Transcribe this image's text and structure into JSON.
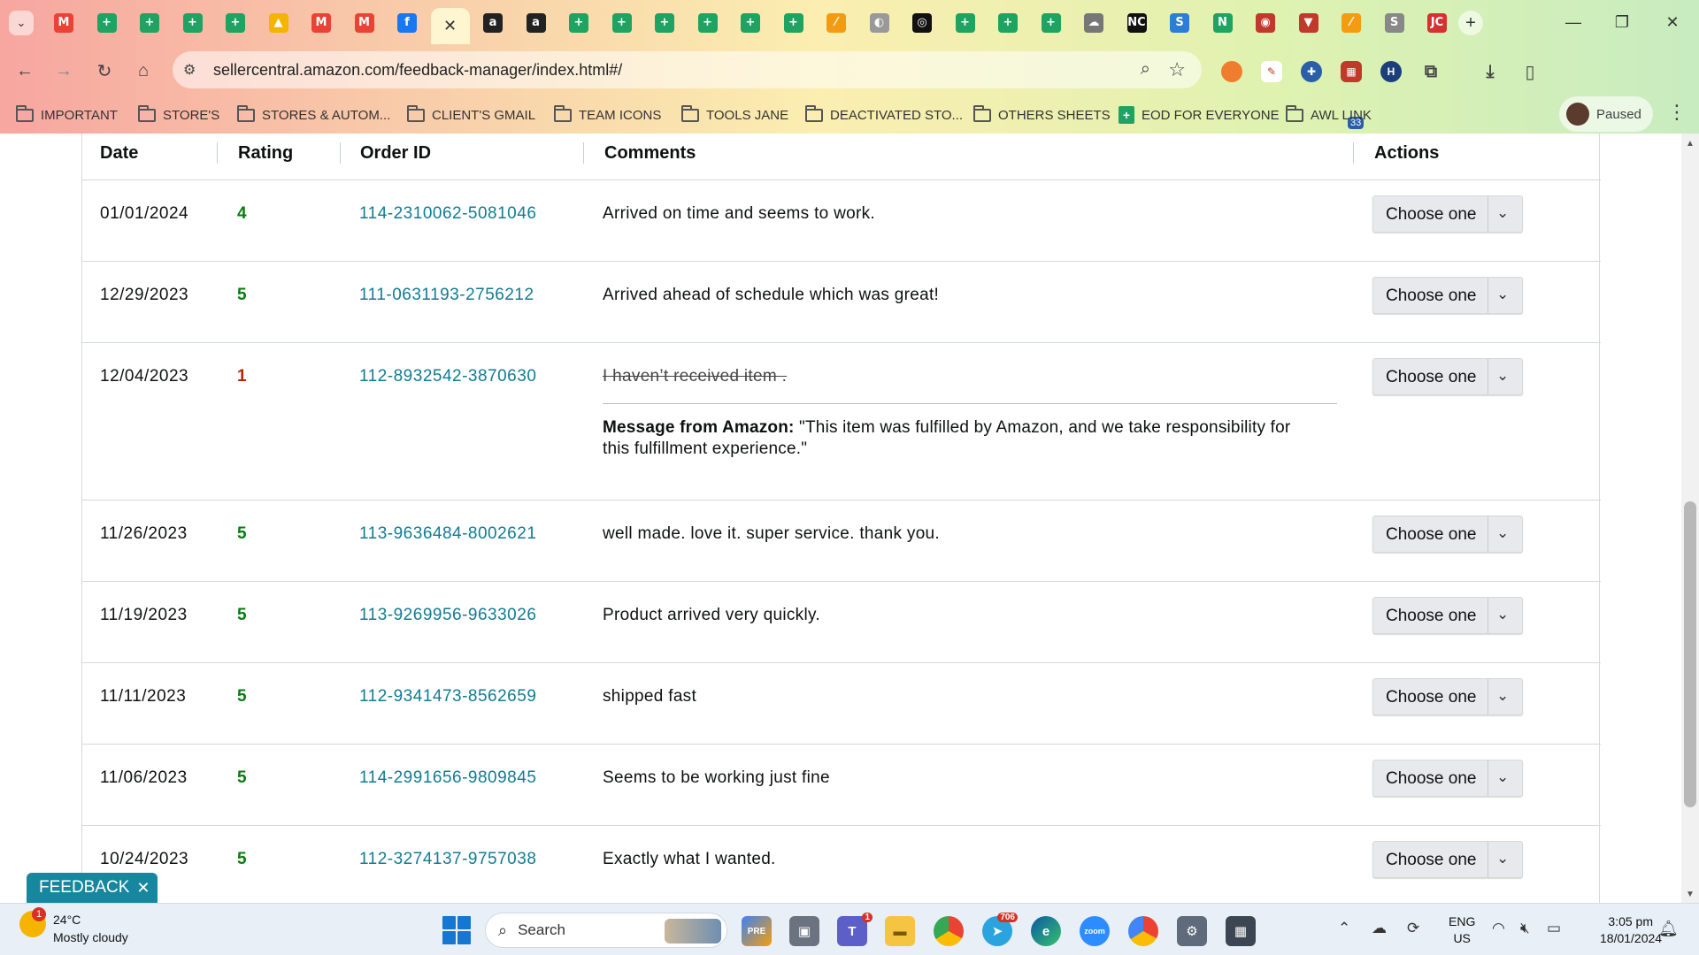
{
  "browser": {
    "url": "sellercentral.amazon.com/feedback-manager/index.html#/",
    "profile_label": "Paused",
    "extension_badge": "33",
    "tabs": [
      {
        "icon": "gmail-icon",
        "glyph": "M",
        "color": "#ea4335"
      },
      {
        "icon": "sheets-icon",
        "glyph": "+",
        "color": "#1ea362"
      },
      {
        "icon": "sheets-icon",
        "glyph": "+",
        "color": "#1ea362"
      },
      {
        "icon": "sheets-icon",
        "glyph": "+",
        "color": "#1ea362"
      },
      {
        "icon": "sheets-icon",
        "glyph": "+",
        "color": "#1ea362"
      },
      {
        "icon": "drive-icon",
        "glyph": "▲",
        "color": "#f4b400"
      },
      {
        "icon": "gmail-icon",
        "glyph": "M",
        "color": "#ea4335"
      },
      {
        "icon": "gmail-icon",
        "glyph": "M",
        "color": "#ea4335"
      },
      {
        "icon": "facebook-icon",
        "glyph": "f",
        "color": "#1877f2"
      },
      {
        "icon": "close-icon",
        "glyph": "✕",
        "color": "transparent",
        "active": true
      },
      {
        "icon": "amazon-icon",
        "glyph": "a",
        "color": "#222"
      },
      {
        "icon": "amazon-icon",
        "glyph": "a",
        "color": "#222"
      },
      {
        "icon": "sheets-icon",
        "glyph": "+",
        "color": "#1ea362"
      },
      {
        "icon": "sheets-icon",
        "glyph": "+",
        "color": "#1ea362"
      },
      {
        "icon": "sheets-icon",
        "glyph": "+",
        "color": "#1ea362"
      },
      {
        "icon": "sheets-icon",
        "glyph": "+",
        "color": "#1ea362"
      },
      {
        "icon": "sheets-icon",
        "glyph": "+",
        "color": "#1ea362"
      },
      {
        "icon": "sheets-icon",
        "glyph": "+",
        "color": "#1ea362"
      },
      {
        "icon": "tasks-icon",
        "glyph": "⁄",
        "color": "#f39c12"
      },
      {
        "icon": "globe-icon",
        "glyph": "◐",
        "color": "#999"
      },
      {
        "icon": "chatgpt-icon",
        "glyph": "◎",
        "color": "#111"
      },
      {
        "icon": "sheets-icon",
        "glyph": "+",
        "color": "#1ea362"
      },
      {
        "icon": "sheets-icon",
        "glyph": "+",
        "color": "#1ea362"
      },
      {
        "icon": "sheets-icon",
        "glyph": "+",
        "color": "#1ea362"
      },
      {
        "icon": "cloud-icon",
        "glyph": "☁",
        "color": "#777"
      },
      {
        "icon": "nc-icon",
        "glyph": "NC",
        "color": "#111"
      },
      {
        "icon": "sysco-icon",
        "glyph": "S",
        "color": "#2a7fd4"
      },
      {
        "icon": "leaf-icon",
        "glyph": "N",
        "color": "#1ea362"
      },
      {
        "icon": "badge-icon",
        "glyph": "◉",
        "color": "#c0392b"
      },
      {
        "icon": "vpn-icon",
        "glyph": "▼",
        "color": "#c0392b"
      },
      {
        "icon": "tasks-icon",
        "glyph": "⁄",
        "color": "#f39c12"
      },
      {
        "icon": "stan-icon",
        "glyph": "S",
        "color": "#888"
      },
      {
        "icon": "jc-icon",
        "glyph": "JC",
        "color": "#d63031"
      }
    ],
    "bookmarks": [
      {
        "label": "IMPORTANT",
        "type": "folder"
      },
      {
        "label": "STORE'S",
        "type": "folder"
      },
      {
        "label": "STORES & AUTOM...",
        "type": "folder"
      },
      {
        "label": "CLIENT'S GMAIL",
        "type": "folder"
      },
      {
        "label": "TEAM ICONS",
        "type": "folder"
      },
      {
        "label": "TOOLS JANE",
        "type": "folder"
      },
      {
        "label": "DEACTIVATED STO...",
        "type": "folder"
      },
      {
        "label": "OTHERS SHEETS",
        "type": "folder"
      },
      {
        "label": "EOD FOR EVERYONE",
        "type": "sheet"
      },
      {
        "label": "AWL LINK",
        "type": "folder"
      }
    ]
  },
  "table": {
    "headers": {
      "date": "Date",
      "rating": "Rating",
      "order_id": "Order ID",
      "comments": "Comments",
      "actions": "Actions"
    },
    "action_label": "Choose one",
    "colors": {
      "positive": "#067d0e",
      "negative": "#b12704",
      "link": "#117b93"
    },
    "rows": [
      {
        "date": "01/01/2024",
        "rating": "4",
        "order_id": "114-2310062-5081046",
        "comment": "Arrived on time and seems to work."
      },
      {
        "date": "12/29/2023",
        "rating": "5",
        "order_id": "111-0631193-2756212",
        "comment": "Arrived ahead of schedule which was great!"
      },
      {
        "date": "12/04/2023",
        "rating": "1",
        "order_id": "112-8932542-3870630",
        "comment": "I haven’t received item .",
        "struck": true,
        "amazon_message_label": "Message from Amazon:",
        "amazon_message": "\"This item was fulfilled by Amazon, and we take responsibility for this fulfillment experience.\""
      },
      {
        "date": "11/26/2023",
        "rating": "5",
        "order_id": "113-9636484-8002621",
        "comment": "well made. love it. super service. thank you."
      },
      {
        "date": "11/19/2023",
        "rating": "5",
        "order_id": "113-9269956-9633026",
        "comment": "Product arrived very quickly."
      },
      {
        "date": "11/11/2023",
        "rating": "5",
        "order_id": "112-9341473-8562659",
        "comment": "shipped fast"
      },
      {
        "date": "11/06/2023",
        "rating": "5",
        "order_id": "114-2991656-9809845",
        "comment": "Seems to be working just fine"
      },
      {
        "date": "10/24/2023",
        "rating": "5",
        "order_id": "112-3274137-9757038",
        "comment": "Exactly what I wanted."
      }
    ]
  },
  "feedback_tab": {
    "label": "FEEDBACK"
  },
  "taskbar": {
    "weather_temp": "24°C",
    "weather_desc": "Mostly cloudy",
    "weather_badge": "1",
    "search_label": "Search",
    "telegram_badge": "706",
    "teams_badge": "1",
    "lang_1": "ENG",
    "lang_2": "US",
    "time": "3:05 pm",
    "date": "18/01/2024"
  }
}
